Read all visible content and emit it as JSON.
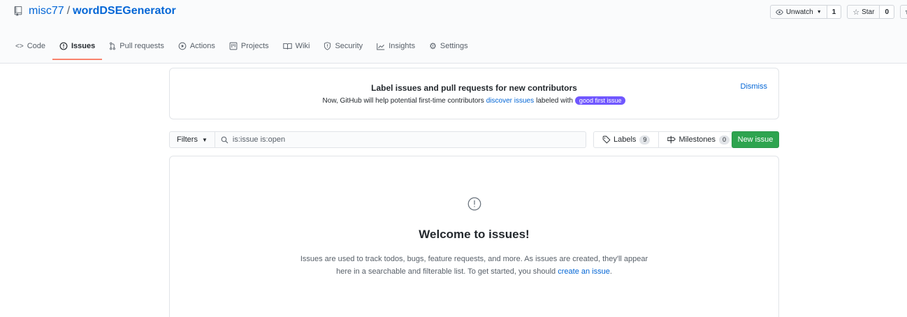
{
  "repo": {
    "owner": "misc77",
    "separator": "/",
    "name": "wordDSEGenerator"
  },
  "header_actions": {
    "watch_label": "Unwatch",
    "watch_count": "1",
    "star_label": "Star",
    "star_count": "0"
  },
  "nav": [
    {
      "label": "Code",
      "icon": "code-icon"
    },
    {
      "label": "Issues",
      "icon": "issue-opened-icon",
      "selected": true
    },
    {
      "label": "Pull requests",
      "icon": "git-pull-request-icon"
    },
    {
      "label": "Actions",
      "icon": "play-icon"
    },
    {
      "label": "Projects",
      "icon": "project-icon"
    },
    {
      "label": "Wiki",
      "icon": "book-icon"
    },
    {
      "label": "Security",
      "icon": "shield-icon"
    },
    {
      "label": "Insights",
      "icon": "graph-icon"
    },
    {
      "label": "Settings",
      "icon": "gear-icon"
    }
  ],
  "banner": {
    "title": "Label issues and pull requests for new contributors",
    "text_before": "Now, GitHub will help potential first-time contributors",
    "link": "discover issues",
    "text_after": "labeled with",
    "label": "good first issue",
    "dismiss": "Dismiss"
  },
  "subnav": {
    "filters": "Filters",
    "search_value": "is:issue is:open",
    "labels": "Labels",
    "labels_count": "9",
    "milestones": "Milestones",
    "milestones_count": "0",
    "new_issue": "New issue"
  },
  "blankslate": {
    "title": "Welcome to issues!",
    "text": "Issues are used to track todos, bugs, feature requests, and more. As issues are created, they'll appear here in a searchable and filterable list. To get started, you should",
    "link": "create an issue",
    "end": "."
  },
  "colors": {
    "accent": "#0366d6",
    "green": "#2ea44f",
    "tab_underline": "#f9826c",
    "good_first_issue": "#7057ff"
  }
}
